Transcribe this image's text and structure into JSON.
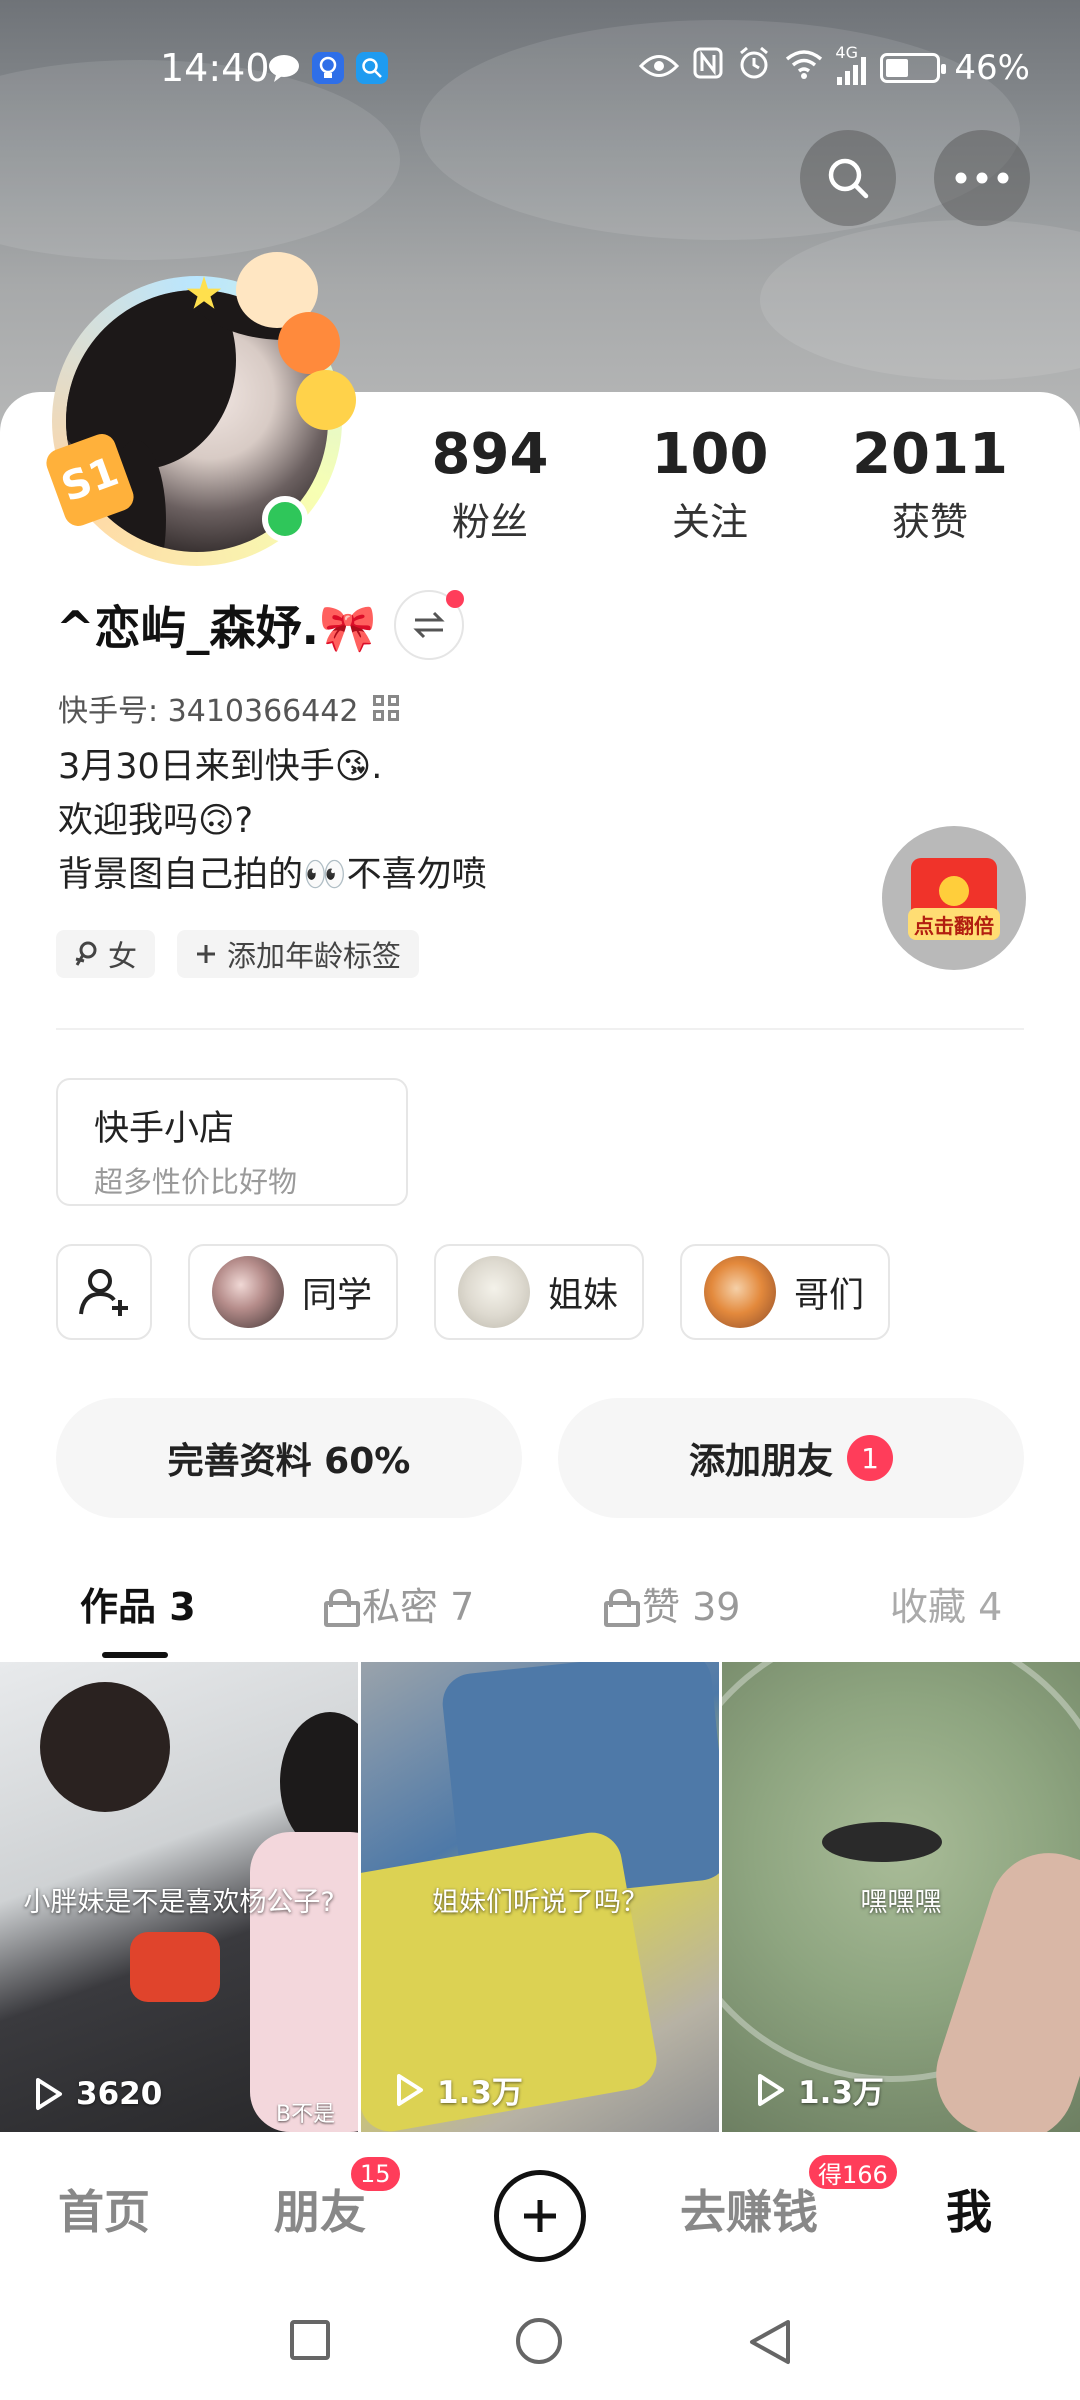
{
  "status_bar": {
    "time": "14:40",
    "network": "4G",
    "battery": "46%",
    "battery_level": 0.46
  },
  "profile": {
    "stats": [
      {
        "value": "894",
        "label": "粉丝"
      },
      {
        "value": "100",
        "label": "关注"
      },
      {
        "value": "2011",
        "label": "获赞"
      }
    ],
    "nickname": "^恋屿_森妤.🎀",
    "kuaishou_id": "快手号: 3410366442",
    "bio": [
      "3月30日来到快手😘.",
      "欢迎我吗🙃?",
      "背景图自己拍的👀不喜勿喷"
    ],
    "tags": [
      {
        "icon": "female-icon",
        "label": "女"
      },
      {
        "icon": "plus-icon",
        "label": "添加年龄标签"
      }
    ],
    "avatar_badge": "S1",
    "red_packet_label": "点击翻倍"
  },
  "shop": {
    "title": "快手小店",
    "subtitle": "超多性价比好物"
  },
  "groups": [
    "同学",
    "姐妹",
    "哥们"
  ],
  "actions": {
    "complete_profile": "完善资料 60%",
    "add_friend": "添加朋友",
    "add_friend_badge": "1"
  },
  "tabs": [
    {
      "label": "作品 3",
      "locked": false,
      "active": true
    },
    {
      "label": "私密 7",
      "locked": true,
      "active": false
    },
    {
      "label": "赞 39",
      "locked": true,
      "active": false
    },
    {
      "label": "收藏 4",
      "locked": false,
      "active": false
    }
  ],
  "videos": [
    {
      "caption": "小胖妹是不是喜欢杨公子?",
      "plays": "3620",
      "corner_text": "B不是"
    },
    {
      "caption": "姐妹们听说了吗？",
      "plays": "1.3万",
      "corner_text": ""
    },
    {
      "caption": "嘿嘿嘿",
      "plays": "1.3万",
      "corner_text": ""
    }
  ],
  "bottom_nav": {
    "home": "首页",
    "friends": "朋友",
    "friends_badge": "15",
    "earn": "去赚钱",
    "earn_badge": "得166",
    "me": "我"
  },
  "colors": {
    "accent_red": "#ff3d5a",
    "online_green": "#2fc65a"
  }
}
